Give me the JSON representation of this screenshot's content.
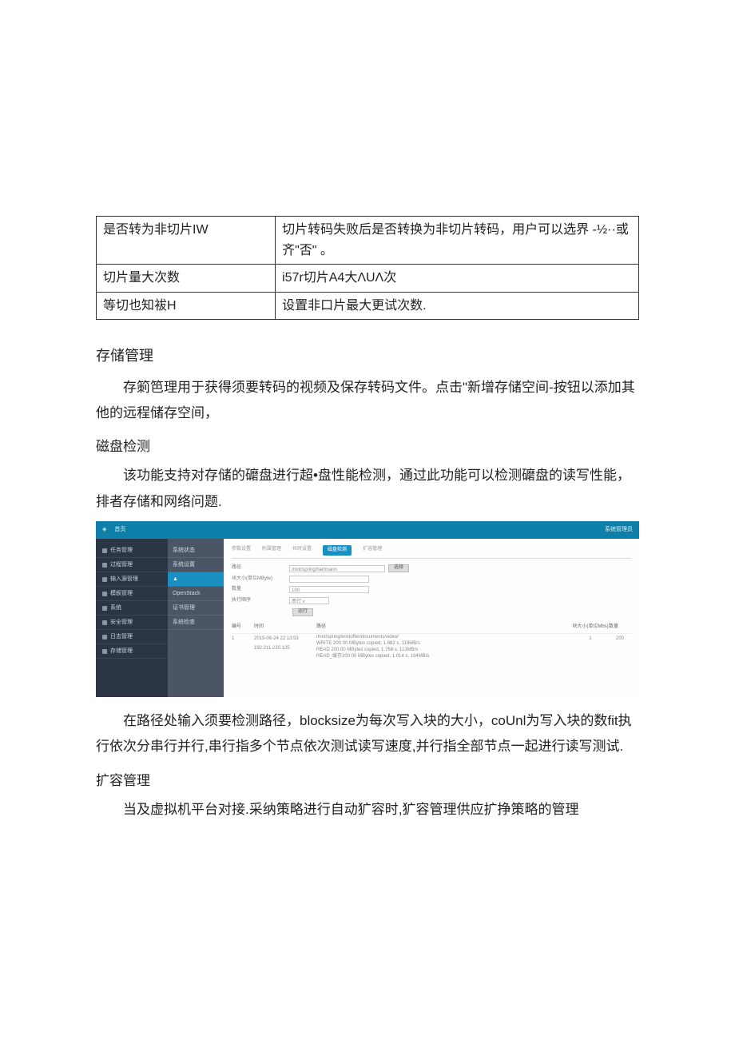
{
  "table": {
    "rows": [
      {
        "k": "是否转为非切片IW",
        "v": "切片转码失败后是否转换为非切片转码，用户可以选界 -½··或齐\"否\"  。"
      },
      {
        "k": "切片量大次数",
        "v": "i57r切片A4大ΛUΛ次"
      },
      {
        "k": "等切也知袚H",
        "v": "设置非口片最大更试次数."
      }
    ]
  },
  "sections": {
    "storage_h": "存储管理",
    "storage_p": "存箣笆理用于获得须要转码的视频及保存转码文件。点击\"新增存储空间-按钮以添加其他的远程储存空间，",
    "disk_h": "磁盘检测",
    "disk_p": "该功能支持对存储的礳盘进行超•盘性能检测，通过此功能可以检测礳盘的读写性能，排者存储和网络问题.",
    "path_p": "在路径处输入须要检测路径，blocksize为每次写入块的大小，coUnl为写入块的数fit执行依次分串行并行,串行指多个节点依次测试读写速度,并行指全部节点一起进行读写测试.",
    "expand_h": "扩容管理",
    "expand_p": "当及虚拟机平台对接.采纳策略进行自动犷容时,犷容管理供应扩挣策略的管理"
  },
  "app": {
    "header": {
      "logo_a": "",
      "logo_b": "首页",
      "user": "系统管理员"
    },
    "sidebar": {
      "items": [
        {
          "label": "任务管理"
        },
        {
          "label": "过程管理"
        },
        {
          "label": "输入源管理"
        },
        {
          "label": "模板管理"
        },
        {
          "label": "系统"
        },
        {
          "label": "安全管理"
        },
        {
          "label": "日志管理"
        },
        {
          "label": "存储管理"
        }
      ]
    },
    "subnav": {
      "items": [
        {
          "label": "系统状态",
          "active": false
        },
        {
          "label": "系统设置",
          "active": false
        },
        {
          "label": "▲",
          "active": true
        },
        {
          "label": "OpenStack",
          "active": false
        },
        {
          "label": "证书管理",
          "active": false
        },
        {
          "label": "系统检查",
          "active": false
        }
      ]
    },
    "tabs": {
      "items": [
        {
          "label": "参数设置",
          "active": false
        },
        {
          "label": "附属管理",
          "active": false
        },
        {
          "label": "长时设置",
          "active": false
        },
        {
          "label": "磁盘检测",
          "active": true
        },
        {
          "label": "扩容管理",
          "active": false
        }
      ]
    },
    "form": {
      "path_lbl": "路径",
      "path_val": "/mnt/spring/hartmann",
      "browse_btn": "选择",
      "block_lbl": "块大小(单位MByte)",
      "block_val": "",
      "count_lbl": "数量",
      "count_val": "100",
      "exec_lbl": "执行顺序",
      "exec_val": "串行 v",
      "run_btn": "运行"
    },
    "results": {
      "head": {
        "c1": "编号",
        "c2": "时间",
        "c3": "路径",
        "c4": "块大小(单位Mbs)",
        "c5": "数量"
      },
      "row": {
        "c1": "1",
        "c2a": "2015-08-24 22:13:53",
        "c2b": "192.211.230.125",
        "c3a": "/mnt/spring/kristoffer/documents/video/",
        "c3b": "WRITE     200.00 MBytes copied, 1.682 s, 119MB/s",
        "c3c": "READ       200.00 MBytes copied, 1.768 s, 113MB/s",
        "c3d": "READ_缓存200.00 MBytes copied, 1.014 s, 194MB/s",
        "c4": "1",
        "c5": "200"
      }
    }
  }
}
